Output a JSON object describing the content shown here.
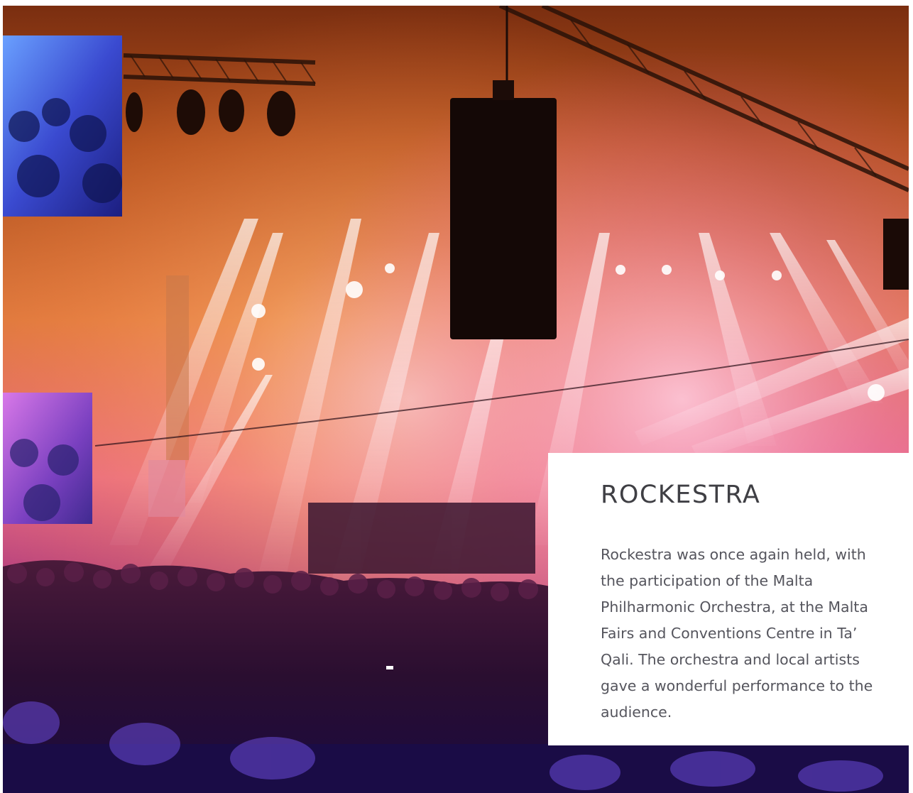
{
  "hero": {
    "image_description_icon": "concert-stage-photo"
  },
  "card": {
    "title": "ROCKESTRA",
    "body": "Rockestra was once again held, with the participation of the Malta Philharmonic Orchestra, at the Malta Fairs and Conventions Centre in Ta’ Qali. The orchestra and local artists gave a wonderful performance to the audience."
  },
  "colors": {
    "background": "#ffffff",
    "title": "#3f3f44",
    "body": "#55555d",
    "stage_glow": "#f07a3a",
    "stage_pink": "#e85aa8"
  }
}
